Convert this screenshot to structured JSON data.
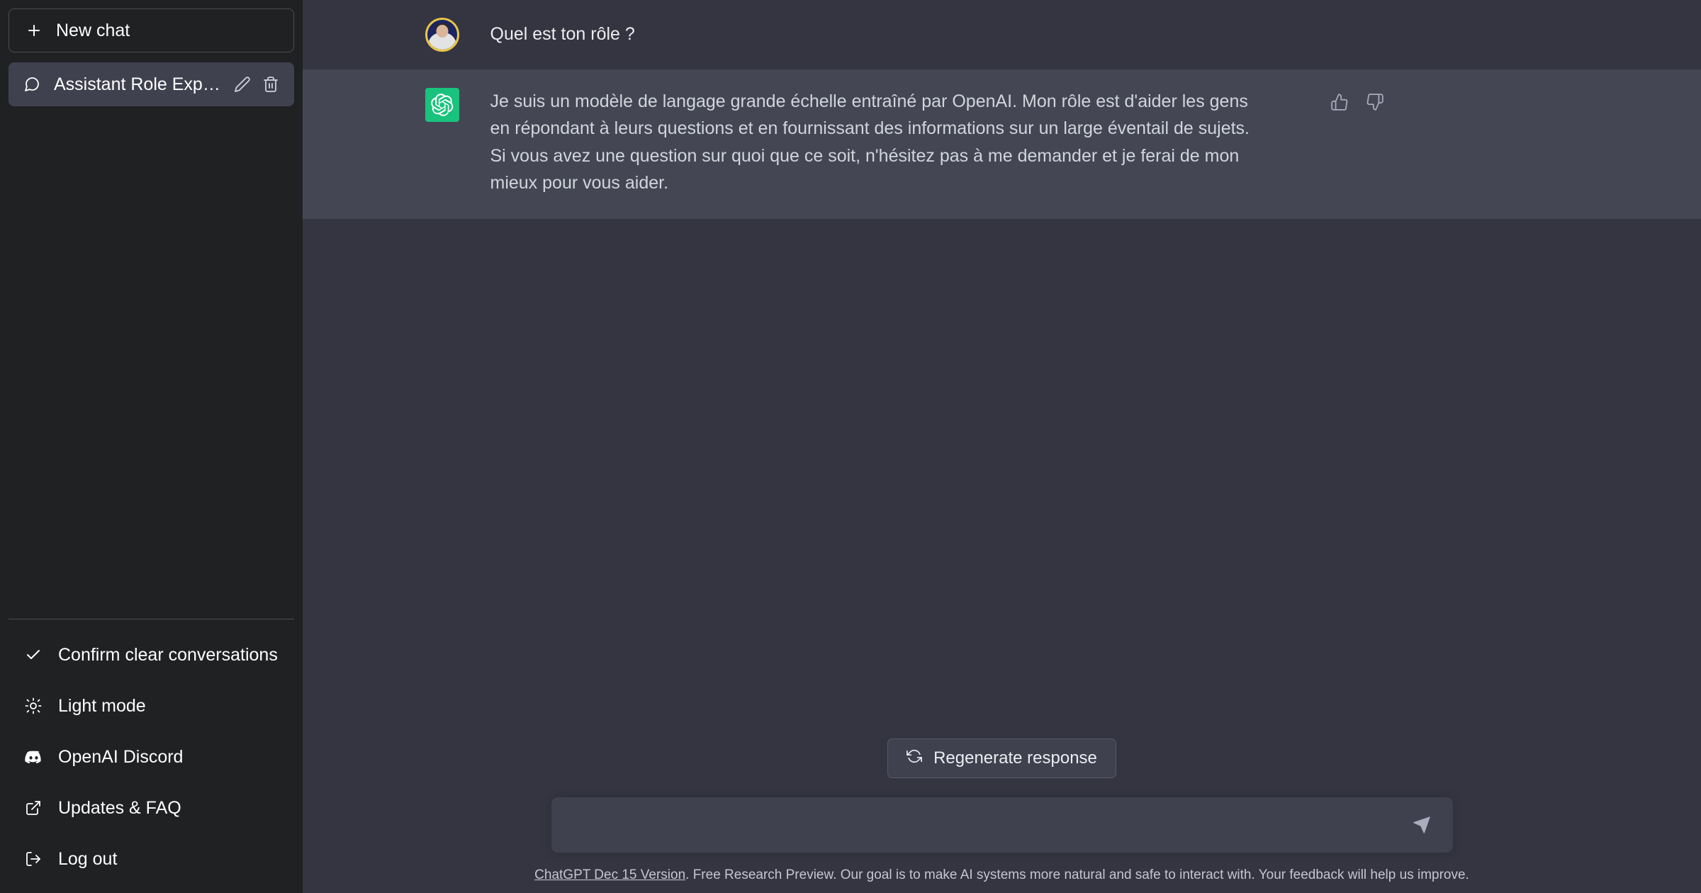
{
  "sidebar": {
    "new_chat": {
      "label": "New chat",
      "icon": "plus-icon"
    },
    "conversations": [
      {
        "label": "Assistant Role Explain",
        "icon": "chat-bubble-icon",
        "edit_icon": "pencil-icon",
        "delete_icon": "trash-icon",
        "active": true
      }
    ],
    "footer_items": [
      {
        "label": "Confirm clear conversations",
        "icon": "check-icon"
      },
      {
        "label": "Light mode",
        "icon": "sun-icon"
      },
      {
        "label": "OpenAI Discord",
        "icon": "discord-icon"
      },
      {
        "label": "Updates & FAQ",
        "icon": "external-link-icon"
      },
      {
        "label": "Log out",
        "icon": "logout-icon"
      }
    ]
  },
  "thread": {
    "messages": [
      {
        "role": "user",
        "avatar": "user-avatar-photo",
        "text": "Quel est ton rôle ?"
      },
      {
        "role": "assistant",
        "avatar": "openai-logo-icon",
        "text": "Je suis un modèle de langage grande échelle entraîné par OpenAI. Mon rôle est d'aider les gens en répondant à leurs questions et en fournissant des informations sur un large éventail de sujets. Si vous avez une question sur quoi que ce soit, n'hésitez pas à me demander et je ferai de mon mieux pour vous aider.",
        "feedback": {
          "thumbs_up_icon": "thumbs-up-icon",
          "thumbs_down_icon": "thumbs-down-icon"
        }
      }
    ]
  },
  "composer": {
    "regenerate_label": "Regenerate response",
    "regenerate_icon": "refresh-icon",
    "input_value": "",
    "input_placeholder": "",
    "send_icon": "send-icon"
  },
  "footer": {
    "version_link": "ChatGPT Dec 15 Version",
    "disclaimer": ". Free Research Preview. Our goal is to make AI systems more natural and safe to interact with. Your feedback will help us improve."
  },
  "colors": {
    "sidebar_bg": "#202123",
    "user_msg_bg": "#343541",
    "assistant_msg_bg": "#444654",
    "accent_green": "#19c37d",
    "input_bg": "#40414f",
    "text_primary": "#ececf1",
    "text_secondary": "#c5c5d2",
    "avatar_ring": "#e8c547"
  }
}
